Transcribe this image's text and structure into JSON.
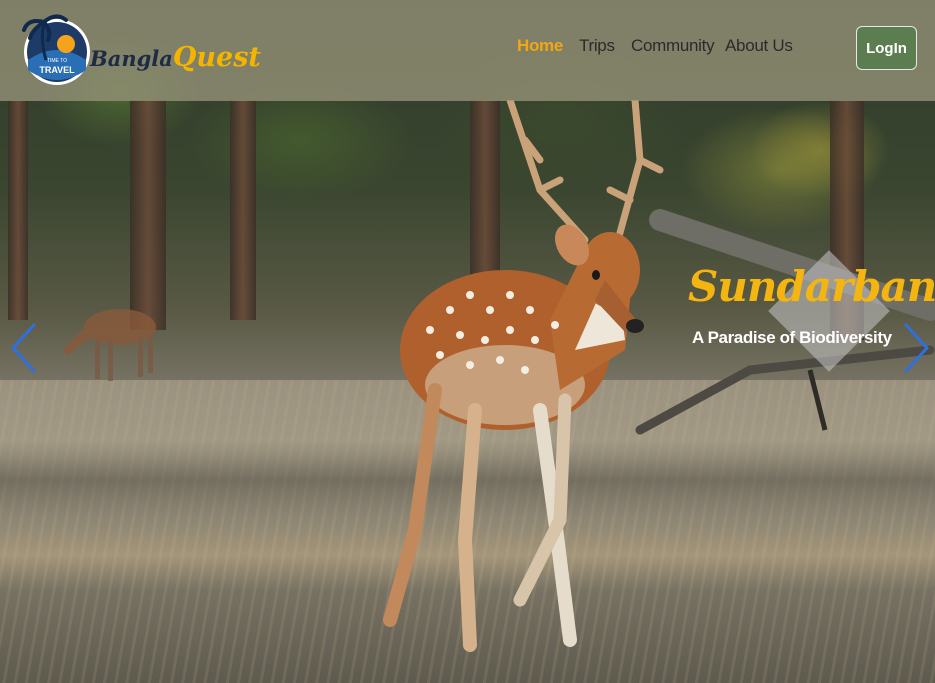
{
  "brand": {
    "badge_top": "TIME TO",
    "badge_bottom": "TRAVEL",
    "name_part1": "Bangla",
    "name_part2": "Quest"
  },
  "nav": {
    "items": [
      {
        "label": "Home",
        "active": true
      },
      {
        "label": "Trips",
        "active": false
      },
      {
        "label": "Community",
        "active": false
      },
      {
        "label": "About Us",
        "active": false
      }
    ],
    "login_label": "LogIn"
  },
  "hero": {
    "title": "Sundarban",
    "subtitle": "A Paradise of Biodiversity",
    "prev_icon": "chevron-left-icon",
    "next_icon": "chevron-right-icon"
  },
  "colors": {
    "accent": "#f4b400",
    "login_bg": "#5b7d4f",
    "arrow": "#2f6fe0",
    "nav_text": "#2b2b2b"
  }
}
